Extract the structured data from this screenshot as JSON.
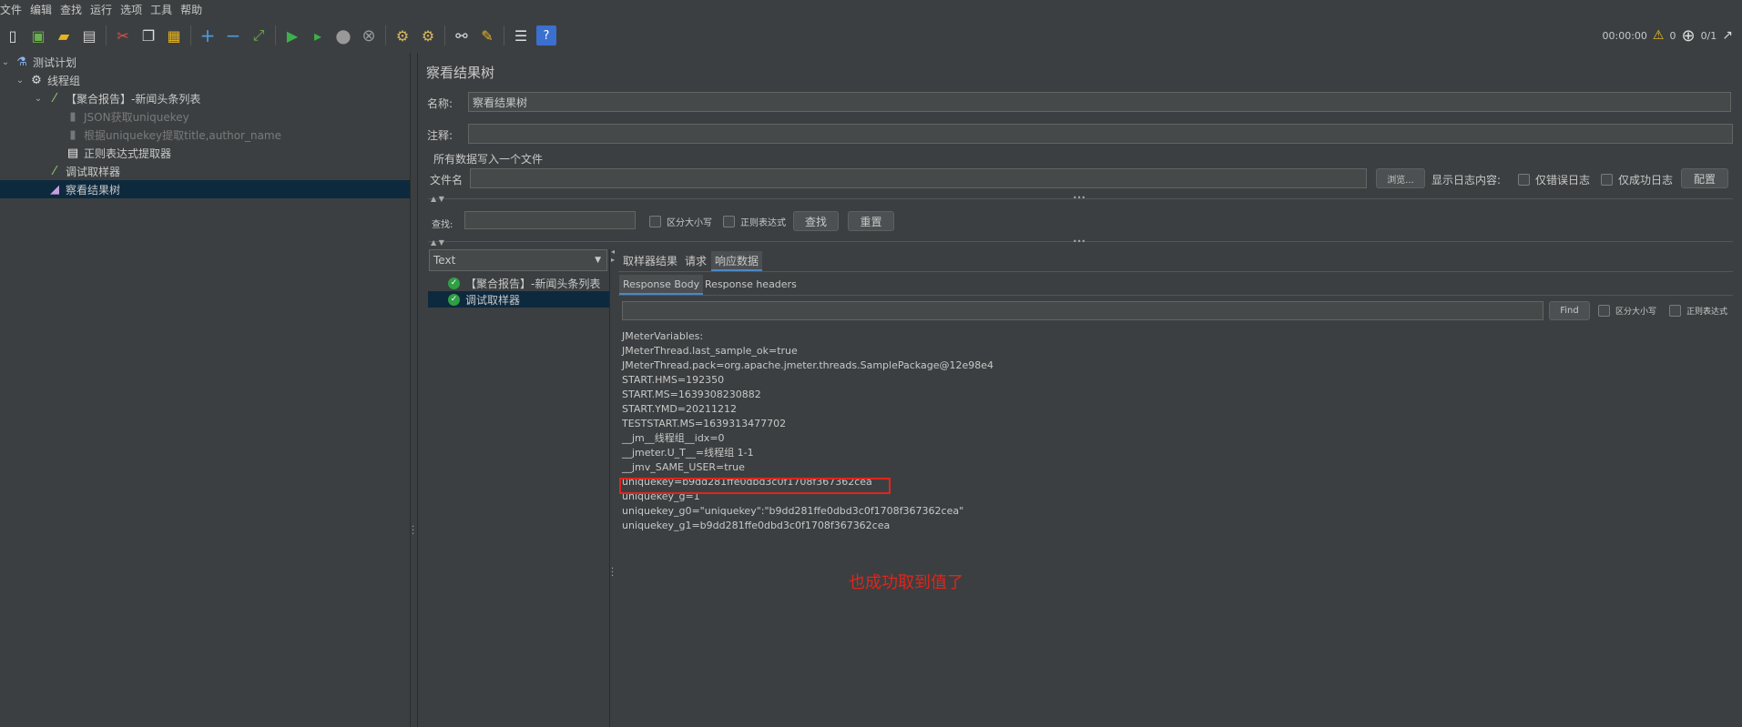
{
  "menu": [
    "文件",
    "编辑",
    "查找",
    "运行",
    "选项",
    "工具",
    "帮助"
  ],
  "toolbar": {
    "icons": [
      "new-icon",
      "templates-icon",
      "open-icon",
      "save-icon",
      "cut-icon",
      "copy-icon",
      "paste-icon",
      "expand-icon",
      "collapse-icon",
      "toggle-icon",
      "start-icon",
      "start-no-pause-icon",
      "stop-icon",
      "shutdown-icon",
      "clear-icon",
      "clear-all-icon",
      "search-icon",
      "reset-search-icon",
      "function-helper-icon",
      "help-icon"
    ],
    "timer": "00:00:00",
    "warnings": "0",
    "threads": "0/1"
  },
  "tree": {
    "items": [
      {
        "label": "测试计划",
        "icon": "flask-icon"
      },
      {
        "label": "线程组",
        "icon": "gear-icon"
      },
      {
        "label": "【聚合报告】-新闻头条列表",
        "icon": "pipette-icon"
      },
      {
        "label": "JSON获取uniquekey",
        "icon": "extractor-icon"
      },
      {
        "label": "根据uniquekey提取title,author_name",
        "icon": "extractor-icon"
      },
      {
        "label": "正则表达式提取器",
        "icon": "regex-icon"
      },
      {
        "label": "调试取样器",
        "icon": "pipette-icon"
      },
      {
        "label": "察看结果树",
        "icon": "chart-icon"
      }
    ]
  },
  "panel": {
    "title": "察看结果树",
    "name_label": "名称:",
    "name_value": "察看结果树",
    "comment_label": "注释:",
    "comment_value": "",
    "file_section": "所有数据写入一个文件",
    "file_label": "文件名",
    "browse": "浏览...",
    "log_label": "显示日志内容:",
    "errors_only": "仅错误日志",
    "success_only": "仅成功日志",
    "configure": "配置",
    "search_label": "查找:",
    "case_sensitive": "区分大小写",
    "regex": "正则表达式",
    "search_button": "查找",
    "reset_button": "重置"
  },
  "results": {
    "renderer": "Text",
    "samples": [
      "【聚合报告】-新闻头条列表",
      "调试取样器"
    ],
    "tabs": [
      "取样器结果",
      "请求",
      "响应数据"
    ],
    "subtabs": [
      "Response Body",
      "Response headers"
    ],
    "find_button": "Find",
    "find_case": "区分大小写",
    "find_regex": "正则表达式",
    "response_lines": [
      "JMeterVariables:",
      "JMeterThread.last_sample_ok=true",
      "JMeterThread.pack=org.apache.jmeter.threads.SamplePackage@12e98e4",
      "START.HMS=192350",
      "START.MS=1639308230882",
      "START.YMD=20211212",
      "TESTSTART.MS=1639313477702",
      "__jm__线程组__idx=0",
      "__jmeter.U_T__=线程组 1-1",
      "__jmv_SAME_USER=true",
      "uniquekey=b9dd281ffe0dbd3c0f1708f367362cea",
      "uniquekey_g=1",
      "uniquekey_g0=\"uniquekey\":\"b9dd281ffe0dbd3c0f1708f367362cea\"",
      "uniquekey_g1=b9dd281ffe0dbd3c0f1708f367362cea"
    ]
  },
  "annotation": "也成功取到值了",
  "colors": {
    "highlight": "#e0251a",
    "selection": "#0d293e",
    "accent": "#4a88c7"
  }
}
